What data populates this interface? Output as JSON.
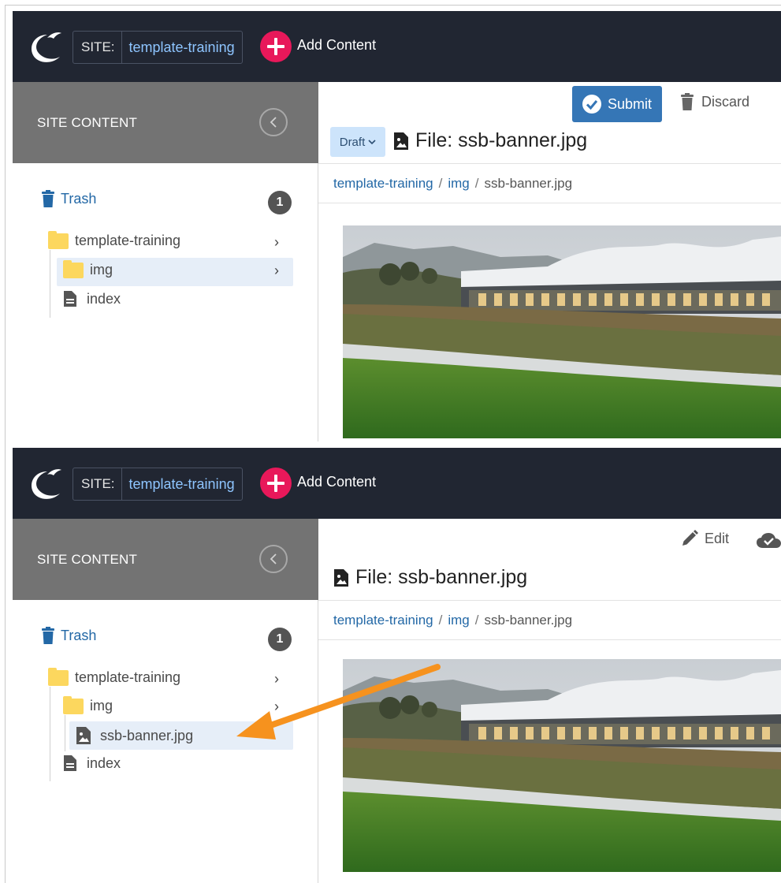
{
  "frames": [
    {
      "topbar": {
        "site_label": "SITE:",
        "site_name": "template-training",
        "add_label": "Add Content"
      },
      "sidebar": {
        "title": "SITE CONTENT",
        "trash": {
          "label": "Trash",
          "count": "1"
        },
        "tree": [
          {
            "label": "template-training",
            "type": "folder"
          },
          {
            "label": "img",
            "type": "folder",
            "selected": true
          },
          {
            "label": "index",
            "type": "page"
          }
        ]
      },
      "toolbar": {
        "submit_label": "Submit",
        "discard_label": "Discard",
        "draft_label": "Draft"
      },
      "title": "File: ssb-banner.jpg",
      "breadcrumb": {
        "root": "template-training",
        "folder": "img",
        "file": "ssb-banner.jpg"
      }
    },
    {
      "topbar": {
        "site_label": "SITE:",
        "site_name": "template-training",
        "add_label": "Add Content"
      },
      "sidebar": {
        "title": "SITE CONTENT",
        "trash": {
          "label": "Trash",
          "count": "1"
        },
        "tree": [
          {
            "label": "template-training",
            "type": "folder"
          },
          {
            "label": "img",
            "type": "folder"
          },
          {
            "label": "ssb-banner.jpg",
            "type": "image",
            "selected": true
          },
          {
            "label": "index",
            "type": "page"
          }
        ]
      },
      "toolbar": {
        "edit_label": "Edit"
      },
      "title": "File: ssb-banner.jpg",
      "breadcrumb": {
        "root": "template-training",
        "folder": "img",
        "file": "ssb-banner.jpg"
      }
    }
  ],
  "colors": {
    "topbar": "#212632",
    "accent_pink": "#e8185a",
    "link_blue": "#2368a6",
    "submit_blue": "#3576b6",
    "folder_yellow": "#fcd75e",
    "annotation_orange": "#f6921e"
  },
  "icons": {
    "logo": "moon-bird-logo",
    "add": "plus-circle-icon",
    "collapse": "chevron-left-circle-icon",
    "trash": "trash-icon",
    "folder": "folder-icon",
    "page": "file-text-icon",
    "image": "file-image-icon",
    "submit": "check-circle-icon",
    "discard": "trash-icon",
    "edit": "pencil-icon",
    "publish": "cloud-check-icon"
  }
}
